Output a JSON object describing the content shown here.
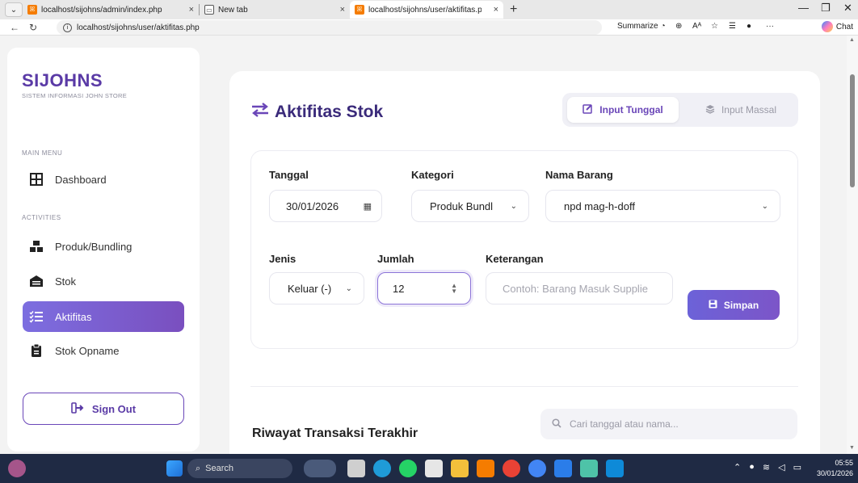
{
  "browser": {
    "tabs": [
      {
        "title": "localhost/sijohns/admin/index.php",
        "close": "×"
      },
      {
        "title": "New tab",
        "close": "×"
      },
      {
        "title": "localhost/sijohns/user/aktifitas.php",
        "close": "×"
      }
    ],
    "new_tab": "+",
    "url": "localhost/sijohns/user/aktifitas.php",
    "summarize_label": "Summarize",
    "chat_label": "Chat"
  },
  "sidebar": {
    "brand": "SIJOHNS",
    "brand_sub": "SISTEM INFORMASI JOHN STORE",
    "main_menu_label": "MAIN MENU",
    "activities_label": "ACTIVITIES",
    "items": [
      {
        "label": "Dashboard",
        "icon": "dashboard-icon"
      },
      {
        "label": "Produk/Bundling",
        "icon": "boxes-icon"
      },
      {
        "label": "Stok",
        "icon": "warehouse-icon"
      },
      {
        "label": "Aktifitas",
        "icon": "list-icon",
        "active": true
      },
      {
        "label": "Stok Opname",
        "icon": "clipboard-icon"
      }
    ],
    "sign_out": "Sign Out"
  },
  "main": {
    "title": "Aktifitas Stok",
    "mode_single": "Input Tunggal",
    "mode_bulk": "Input Massal",
    "form": {
      "tanggal_label": "Tanggal",
      "tanggal_value": "30/01/2026",
      "kategori_label": "Kategori",
      "kategori_value": "Produk Bundl",
      "nama_label": "Nama Barang",
      "nama_value": "npd mag-h-doff",
      "jenis_label": "Jenis",
      "jenis_value": "Keluar (-)",
      "jumlah_label": "Jumlah",
      "jumlah_value": "12",
      "keterangan_label": "Keterangan",
      "keterangan_placeholder": "Contoh: Barang Masuk Supplie",
      "save_label": "Simpan"
    },
    "history_title": "Riwayat Transaksi Terakhir",
    "search_placeholder": "Cari tanggal atau nama..."
  },
  "taskbar": {
    "search_label": "Search",
    "time": "05:55",
    "date": "30/01/2026"
  },
  "colors": {
    "accent": "#6a46b8",
    "active_gradient_start": "#7c6ee0",
    "taskbar": "#1f2a44"
  }
}
